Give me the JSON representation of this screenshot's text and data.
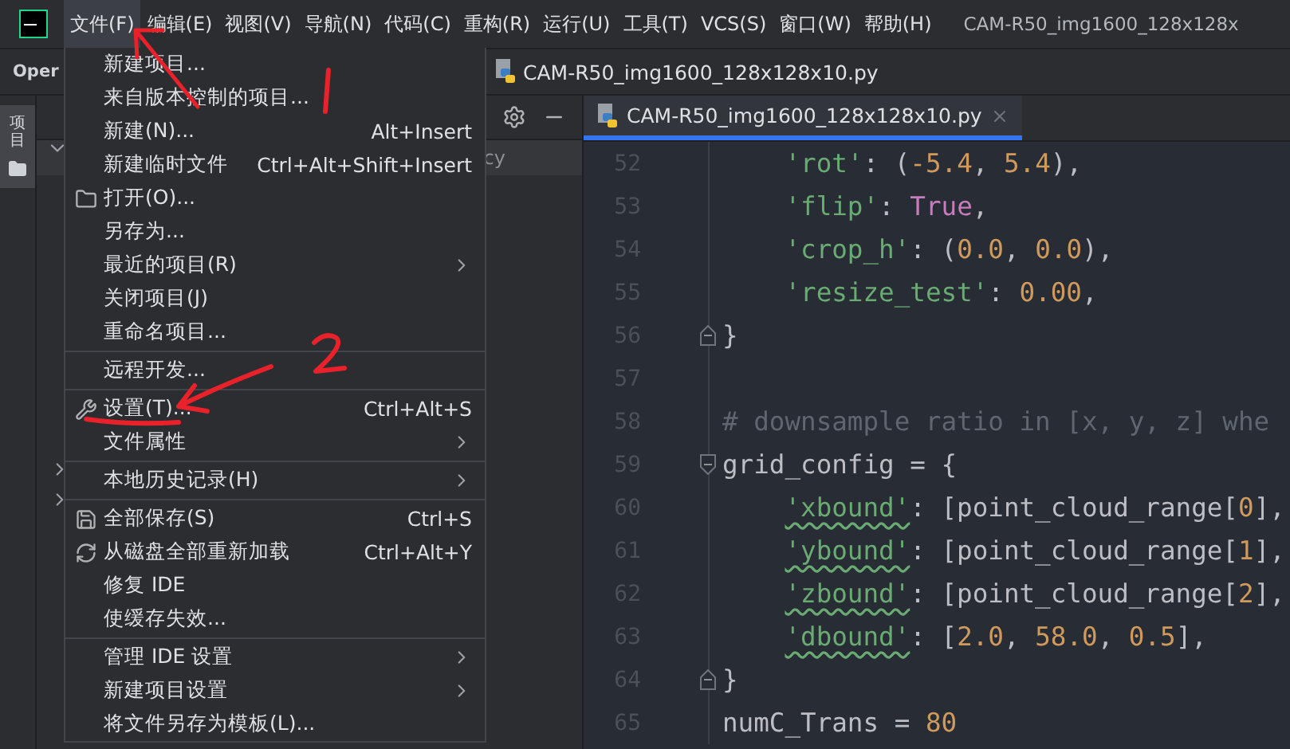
{
  "menu_bar": {
    "items": [
      {
        "label": "文件(F)",
        "selected": true
      },
      {
        "label": "编辑(E)",
        "selected": false
      },
      {
        "label": "视图(V)",
        "selected": false
      },
      {
        "label": "导航(N)",
        "selected": false
      },
      {
        "label": "代码(C)",
        "selected": false
      },
      {
        "label": "重构(R)",
        "selected": false
      },
      {
        "label": "运行(U)",
        "selected": false
      },
      {
        "label": "工具(T)",
        "selected": false
      },
      {
        "label": "VCS(S)",
        "selected": false
      },
      {
        "label": "窗口(W)",
        "selected": false
      },
      {
        "label": "帮助(H)",
        "selected": false
      }
    ],
    "window_title": "CAM-R50_img1600_128x128x"
  },
  "project_panel": {
    "title": "Oper",
    "stripe_tab": {
      "label": "项目",
      "selected": true
    },
    "row_text": "cy"
  },
  "breadcrumb": "CAM-R50_img1600_128x128x10.py",
  "editor_tabs": [
    {
      "label": "CAM-R50_img1600_128x128x10.py",
      "selected": true
    }
  ],
  "file_menu": {
    "sections": [
      {
        "items": [
          {
            "kind": "plain",
            "label": "新建项目...",
            "submenu": false
          },
          {
            "kind": "plain",
            "label": "来自版本控制的项目...",
            "submenu": false
          },
          {
            "kind": "plain",
            "label": "新建(N)...",
            "shortcut": "Alt+Insert",
            "submenu": false
          },
          {
            "kind": "plain",
            "label": "新建临时文件",
            "shortcut": "Ctrl+Alt+Shift+Insert",
            "submenu": false
          },
          {
            "kind": "folder",
            "label": "打开(O)...",
            "submenu": false
          },
          {
            "kind": "plain",
            "label": "另存为...",
            "submenu": false
          },
          {
            "kind": "plain",
            "label": "最近的项目(R)",
            "submenu": true
          },
          {
            "kind": "plain",
            "label": "关闭项目(J)",
            "submenu": false
          },
          {
            "kind": "plain",
            "label": "重命名项目...",
            "submenu": false
          }
        ]
      },
      {
        "items": [
          {
            "kind": "plain",
            "label": "远程开发...",
            "submenu": false
          }
        ]
      },
      {
        "items": [
          {
            "kind": "wrench",
            "label": "设置(T)...",
            "shortcut": "Ctrl+Alt+S",
            "submenu": false
          },
          {
            "kind": "plain",
            "label": "文件属性",
            "submenu": true
          }
        ]
      },
      {
        "items": [
          {
            "kind": "plain",
            "label": "本地历史记录(H)",
            "submenu": true
          }
        ]
      },
      {
        "items": [
          {
            "kind": "save",
            "label": "全部保存(S)",
            "shortcut": "Ctrl+S",
            "submenu": false
          },
          {
            "kind": "reload",
            "label": "从磁盘全部重新加载",
            "shortcut": "Ctrl+Alt+Y",
            "submenu": false
          },
          {
            "kind": "plain",
            "label": "修复 IDE",
            "submenu": false
          },
          {
            "kind": "plain",
            "label": "使缓存失效...",
            "submenu": false
          }
        ]
      },
      {
        "items": [
          {
            "kind": "plain",
            "label": "管理 IDE 设置",
            "submenu": true
          },
          {
            "kind": "plain",
            "label": "新建项目设置",
            "submenu": true
          },
          {
            "kind": "plain",
            "label": "将文件另存为模板(L)...",
            "submenu": false
          }
        ]
      }
    ]
  },
  "code_lines": [
    {
      "number": "52",
      "fold_open": false,
      "fold_close": false,
      "tokens": [
        {
          "kind": "string",
          "text": "    'rot'"
        },
        {
          "kind": "text",
          "text": ": ("
        },
        {
          "kind": "number",
          "text": "-5.4"
        },
        {
          "kind": "text",
          "text": ", "
        },
        {
          "kind": "number",
          "text": "5.4"
        },
        {
          "kind": "text",
          "text": "),"
        }
      ]
    },
    {
      "number": "53",
      "fold_open": false,
      "fold_close": false,
      "tokens": [
        {
          "kind": "string",
          "text": "    'flip'"
        },
        {
          "kind": "text",
          "text": ": "
        },
        {
          "kind": "keyword",
          "text": "True"
        },
        {
          "kind": "text",
          "text": ","
        }
      ]
    },
    {
      "number": "54",
      "fold_open": false,
      "fold_close": false,
      "tokens": [
        {
          "kind": "string",
          "text": "    'crop_h'"
        },
        {
          "kind": "text",
          "text": ": ("
        },
        {
          "kind": "number",
          "text": "0.0"
        },
        {
          "kind": "text",
          "text": ", "
        },
        {
          "kind": "number",
          "text": "0.0"
        },
        {
          "kind": "text",
          "text": "),"
        }
      ]
    },
    {
      "number": "55",
      "fold_open": false,
      "fold_close": false,
      "tokens": [
        {
          "kind": "string",
          "text": "    'resize_test'"
        },
        {
          "kind": "text",
          "text": ": "
        },
        {
          "kind": "number",
          "text": "0.00"
        },
        {
          "kind": "text",
          "text": ","
        }
      ]
    },
    {
      "number": "56",
      "fold_open": false,
      "fold_close": true,
      "tokens": [
        {
          "kind": "text",
          "text": "}"
        }
      ]
    },
    {
      "number": "57",
      "fold_open": false,
      "fold_close": false
    },
    {
      "number": "58",
      "fold_open": false,
      "fold_close": false,
      "tokens": [
        {
          "kind": "comment",
          "text": "# downsample ratio in [x, y, z] whe"
        }
      ]
    },
    {
      "number": "59",
      "fold_open": true,
      "fold_close": false,
      "tokens": [
        {
          "kind": "text",
          "text": "grid_config = {"
        }
      ]
    },
    {
      "number": "60",
      "fold_open": false,
      "fold_close": false,
      "tokens": [
        {
          "kind": "typo_string",
          "text": "    'xbound'"
        },
        {
          "kind": "text",
          "text": ": [point_cloud_range["
        },
        {
          "kind": "number",
          "text": "0"
        },
        {
          "kind": "text",
          "text": "],"
        }
      ]
    },
    {
      "number": "61",
      "fold_open": false,
      "fold_close": false,
      "tokens": [
        {
          "kind": "typo_string",
          "text": "    'ybound'"
        },
        {
          "kind": "text",
          "text": ": [point_cloud_range["
        },
        {
          "kind": "number",
          "text": "1"
        },
        {
          "kind": "text",
          "text": "],"
        }
      ]
    },
    {
      "number": "62",
      "fold_open": false,
      "fold_close": false,
      "tokens": [
        {
          "kind": "typo_string",
          "text": "    'zbound'"
        },
        {
          "kind": "text",
          "text": ": [point_cloud_range["
        },
        {
          "kind": "number",
          "text": "2"
        },
        {
          "kind": "text",
          "text": "],"
        }
      ]
    },
    {
      "number": "63",
      "fold_open": false,
      "fold_close": false,
      "tokens": [
        {
          "kind": "typo_string",
          "text": "    'dbound'"
        },
        {
          "kind": "text",
          "text": ": ["
        },
        {
          "kind": "number",
          "text": "2.0"
        },
        {
          "kind": "text",
          "text": ", "
        },
        {
          "kind": "number",
          "text": "58.0"
        },
        {
          "kind": "text",
          "text": ", "
        },
        {
          "kind": "number",
          "text": "0.5"
        },
        {
          "kind": "text",
          "text": "],"
        }
      ]
    },
    {
      "number": "64",
      "fold_open": false,
      "fold_close": true,
      "tokens": [
        {
          "kind": "text",
          "text": "}"
        }
      ]
    },
    {
      "number": "65",
      "fold_open": false,
      "fold_close": false,
      "tokens": [
        {
          "kind": "text",
          "text": "numC_Trans = "
        },
        {
          "kind": "number",
          "text": "80"
        }
      ]
    }
  ]
}
